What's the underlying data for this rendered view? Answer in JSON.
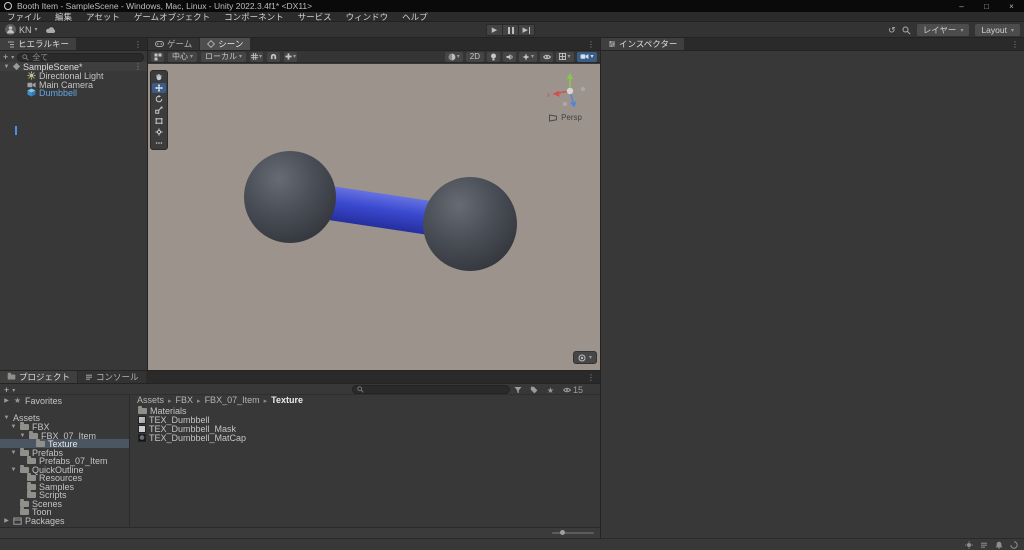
{
  "window": {
    "title": "Booth Item - SampleScene - Windows, Mac, Linux - Unity 2022.3.4f1* <DX11>",
    "minimize": "–",
    "maximize": "□",
    "close": "×"
  },
  "menu": {
    "items": [
      "ファイル",
      "編集",
      "アセット",
      "ゲームオブジェクト",
      "コンポーネント",
      "サービス",
      "ウィンドウ",
      "ヘルプ"
    ]
  },
  "toolbar": {
    "account": "KN",
    "layers": "レイヤー",
    "layout": "Layout"
  },
  "hierarchy": {
    "tab": "ヒエラルキー",
    "search_placeholder": "全て",
    "scene_label": "SampleScene*",
    "items": [
      {
        "label": "Directional Light"
      },
      {
        "label": "Main Camera"
      },
      {
        "label": "Dumbbell"
      }
    ]
  },
  "scene": {
    "tab_game": "ゲーム",
    "tab_scene": "シーン",
    "pivot": "中心",
    "orientation": "ローカル",
    "two_d": "2D",
    "projection": "Persp",
    "gizmo_x": "x"
  },
  "inspector": {
    "tab": "インスペクター"
  },
  "project": {
    "tab_project": "プロジェクト",
    "tab_console": "コンソール",
    "hidden_count": "15",
    "tree": [
      {
        "label": "Favorites",
        "tri": "▶"
      },
      {
        "label": "Assets",
        "tri": "▼"
      },
      {
        "label": "FBX",
        "tri": "▼"
      },
      {
        "label": "FBX_07_Item",
        "tri": "▼"
      },
      {
        "label": "Texture",
        "tri": ""
      },
      {
        "label": "Prefabs",
        "tri": "▼"
      },
      {
        "label": "Prefabs_07_Item",
        "tri": ""
      },
      {
        "label": "QuickOutline",
        "tri": "▼"
      },
      {
        "label": "Resources",
        "tri": ""
      },
      {
        "label": "Samples",
        "tri": ""
      },
      {
        "label": "Scripts",
        "tri": ""
      },
      {
        "label": "Scenes",
        "tri": ""
      },
      {
        "label": "Toon",
        "tri": ""
      },
      {
        "label": "Packages",
        "tri": "▶"
      }
    ],
    "breadcrumb": [
      {
        "label": "Assets"
      },
      {
        "label": "FBX"
      },
      {
        "label": "FBX_07_Item"
      },
      {
        "label": "Texture"
      }
    ],
    "files": [
      {
        "label": "Materials"
      },
      {
        "label": "TEX_Dumbbell"
      },
      {
        "label": "TEX_Dumbbell_Mask"
      },
      {
        "label": "TEX_Dumbbell_MatCap"
      }
    ]
  },
  "colors": {
    "selection_blue": "#3d5c84",
    "prefab_text_blue": "#64a6e8",
    "viewport_background": "#9c948c",
    "dumbbell_handle_blue": "#3a49cf",
    "dumbbell_sphere_gray": "#43474f"
  }
}
